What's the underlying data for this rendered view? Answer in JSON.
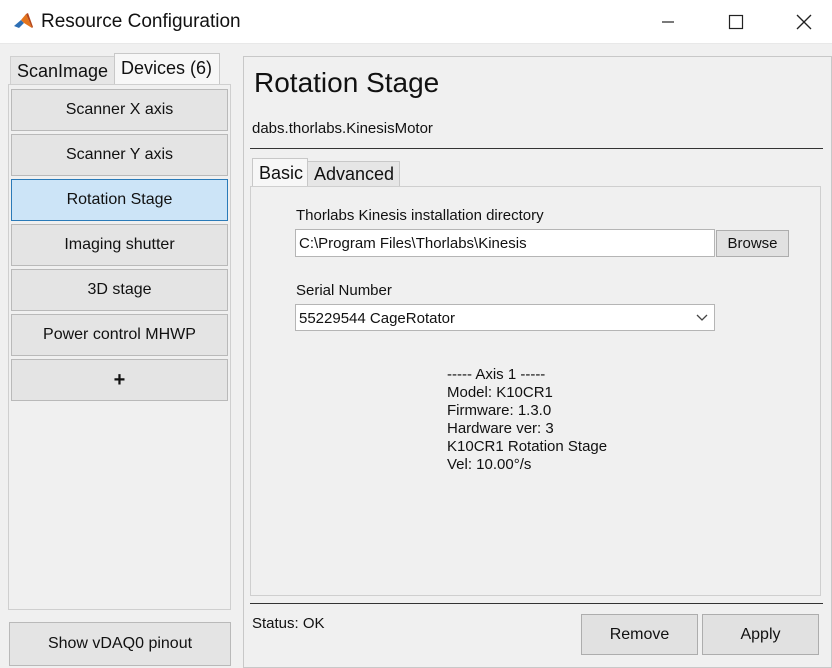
{
  "window": {
    "title": "Resource Configuration"
  },
  "left": {
    "tabs": [
      {
        "label": "ScanImage"
      },
      {
        "label": "Devices (6)"
      }
    ],
    "devices": [
      {
        "label": "Scanner X axis"
      },
      {
        "label": "Scanner Y axis"
      },
      {
        "label": "Rotation Stage",
        "selected": true
      },
      {
        "label": "Imaging shutter"
      },
      {
        "label": "3D stage"
      },
      {
        "label": "Power control MHWP"
      },
      {
        "label": "+"
      }
    ],
    "vdaq_button": "Show vDAQ0 pinout"
  },
  "main": {
    "title": "Rotation Stage",
    "class_name": "dabs.thorlabs.KinesisMotor",
    "tabs": [
      {
        "label": "Basic"
      },
      {
        "label": "Advanced"
      }
    ],
    "dir_label": "Thorlabs Kinesis installation directory",
    "dir_value": "C:\\Program Files\\Thorlabs\\Kinesis",
    "browse_label": "Browse",
    "serial_label": "Serial Number",
    "serial_value": "55229544 CageRotator",
    "info_lines": [
      "----- Axis 1 -----",
      "Model: K10CR1",
      "Firmware: 1.3.0",
      "Hardware ver: 3",
      "K10CR1 Rotation Stage",
      "Vel: 10.00°/s"
    ],
    "status": "Status: OK",
    "remove_label": "Remove",
    "apply_label": "Apply"
  },
  "colors": {
    "selected_bg": "#cce4f7",
    "selected_border": "#2a7ab8",
    "panel_bg": "#f0f0f0"
  }
}
